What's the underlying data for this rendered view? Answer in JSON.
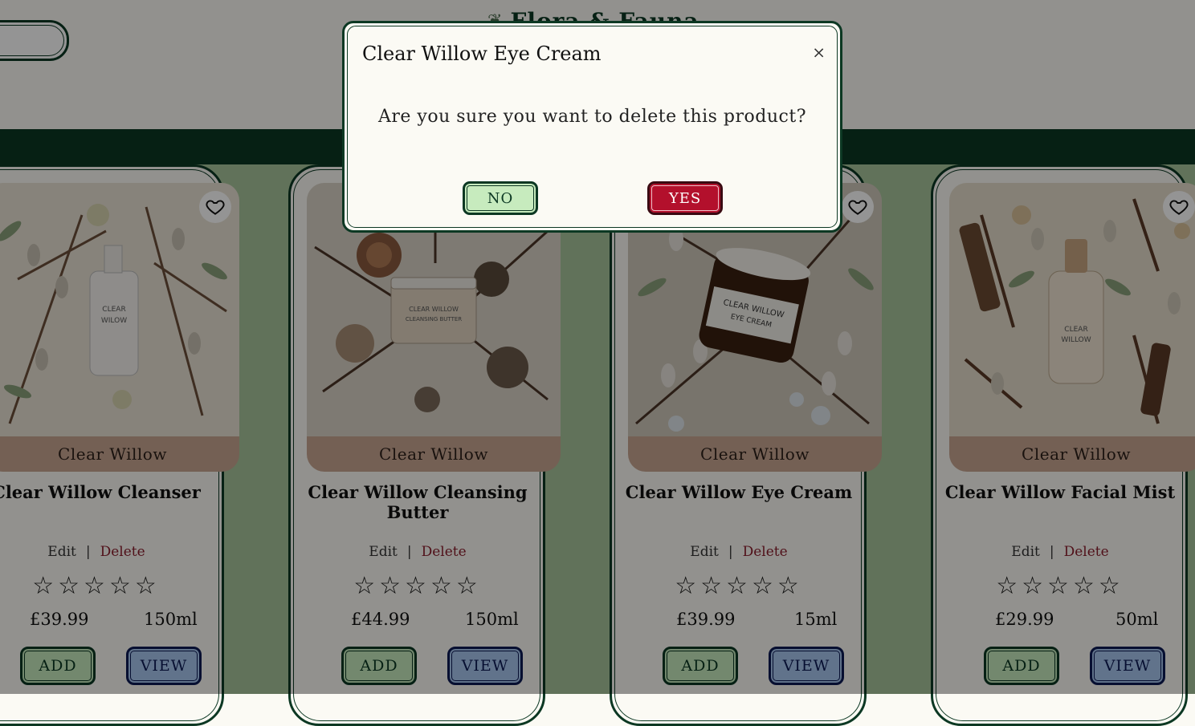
{
  "header": {
    "logo_text": "Flora & Fauna"
  },
  "products": [
    {
      "brand": "Clear Willow",
      "name": "Clear Willow Cleanser",
      "edit_label": "Edit",
      "delete_label": "Delete",
      "separator": "|",
      "rating": 0,
      "max_rating": 5,
      "price": "£39.99",
      "size": "150ml",
      "add_label": "ADD",
      "view_label": "VIEW"
    },
    {
      "brand": "Clear Willow",
      "name": "Clear Willow Cleansing Butter",
      "edit_label": "Edit",
      "delete_label": "Delete",
      "separator": "|",
      "rating": 0,
      "max_rating": 5,
      "price": "£44.99",
      "size": "150ml",
      "add_label": "ADD",
      "view_label": "VIEW"
    },
    {
      "brand": "Clear Willow",
      "name": "Clear Willow Eye Cream",
      "edit_label": "Edit",
      "delete_label": "Delete",
      "separator": "|",
      "rating": 0,
      "max_rating": 5,
      "price": "£39.99",
      "size": "15ml",
      "add_label": "ADD",
      "view_label": "VIEW"
    },
    {
      "brand": "Clear Willow",
      "name": "Clear Willow Facial Mist",
      "edit_label": "Edit",
      "delete_label": "Delete",
      "separator": "|",
      "rating": 0,
      "max_rating": 5,
      "price": "£29.99",
      "size": "50ml",
      "add_label": "ADD",
      "view_label": "VIEW"
    }
  ],
  "modal": {
    "title": "Clear Willow Eye Cream",
    "close_glyph": "×",
    "message": "Are you sure you want to delete this product?",
    "no_label": "NO",
    "yes_label": "YES"
  },
  "icons": {
    "heart": "heart-icon",
    "star": "star-outline-icon",
    "close": "close-icon"
  },
  "colors": {
    "forest": "#0c3823",
    "sage": "#a7c49b",
    "blush": "#c8a592",
    "add_green": "#c7ebbe",
    "view_blue": "#a7c7f0",
    "yes_red": "#b3102c",
    "delete_red": "#8b1d2c"
  }
}
